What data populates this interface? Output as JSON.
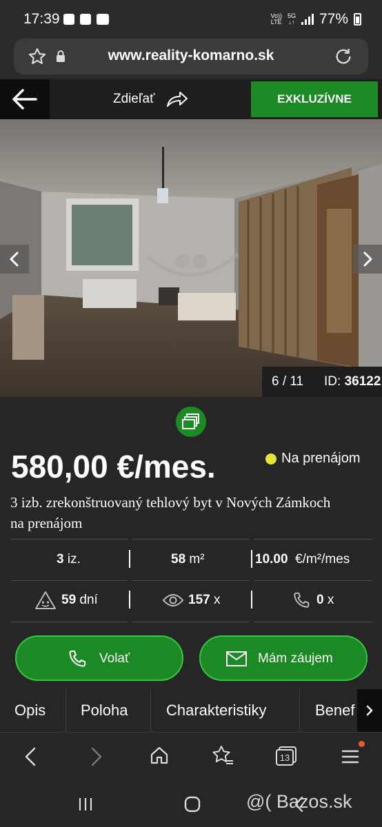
{
  "status_bar": {
    "time": "17:39",
    "network_label_top": "Vo))",
    "network_label_bottom": "LTE",
    "generation": "5G",
    "battery": "77%"
  },
  "url_bar": {
    "url": "www.reality-komarno.sk"
  },
  "header": {
    "share_label": "Zdieľať",
    "exclusive_label": "EXKLUZÍVNE"
  },
  "gallery": {
    "counter": "6 / 11",
    "id_label": "ID:",
    "id_value": "36122"
  },
  "listing": {
    "price": "580,00 €/mes.",
    "status": "Na prenájom",
    "title": "3 izb. zrekonštruovaný tehlový byt v Nových Zámkoch na prenájom",
    "rooms_value": "3",
    "rooms_unit": "iz.",
    "area_value": "58",
    "area_unit": "m²",
    "price_per_m2_value": "10.00",
    "price_per_m2_unit": "€/m²/mes",
    "days_value": "59",
    "days_unit": "dní",
    "views_value": "157",
    "views_unit": "x",
    "calls_value": "0",
    "calls_unit": "x"
  },
  "actions": {
    "call_label": "Volať",
    "interest_label": "Mám záujem"
  },
  "tabs": [
    "Opis",
    "Poloha",
    "Charakteristiky",
    "Benef"
  ],
  "browser_nav": {
    "tab_count": "13"
  },
  "watermark": "@( Bazos.sk",
  "colors": {
    "accent": "#1b8a24",
    "accent_border": "#3ac447",
    "status_dot": "#e8e43a",
    "background": "#262626"
  }
}
